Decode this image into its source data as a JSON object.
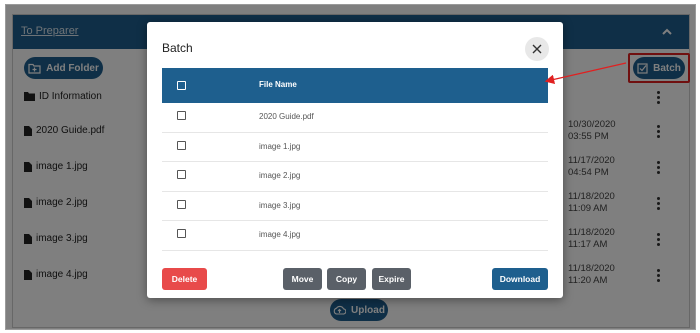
{
  "header": {
    "link": "To Preparer"
  },
  "toolbar": {
    "add_folder": "Add Folder",
    "batch": "Batch",
    "upload": "Upload"
  },
  "items": [
    {
      "name": "ID Information",
      "type": "folder",
      "date": "",
      "time": ""
    },
    {
      "name": "2020 Guide.pdf",
      "type": "file",
      "date": "10/30/2020",
      "time": "03:55 PM"
    },
    {
      "name": "image 1.jpg",
      "type": "file",
      "date": "11/17/2020",
      "time": "04:54 PM"
    },
    {
      "name": "image 2.jpg",
      "type": "file",
      "date": "11/18/2020",
      "time": "11:09 AM"
    },
    {
      "name": "image 3.jpg",
      "type": "file",
      "date": "11/18/2020",
      "time": "11:17 AM"
    },
    {
      "name": "image 4.jpg",
      "type": "file",
      "date": "11/18/2020",
      "time": "11:20 AM"
    }
  ],
  "modal": {
    "title": "Batch",
    "close_icon": "close-icon",
    "column_header": "File Name",
    "files": [
      "2020 Guide.pdf",
      "image 1.jpg",
      "image 2.jpg",
      "image 3.jpg",
      "image 4.jpg"
    ],
    "buttons": {
      "delete": "Delete",
      "move": "Move",
      "copy": "Copy",
      "expire": "Expire",
      "download": "Download"
    }
  },
  "colors": {
    "primary": "#1e5f8e",
    "danger": "#e84a4a",
    "secondary": "#5a6068",
    "annotation": "#e02020"
  }
}
